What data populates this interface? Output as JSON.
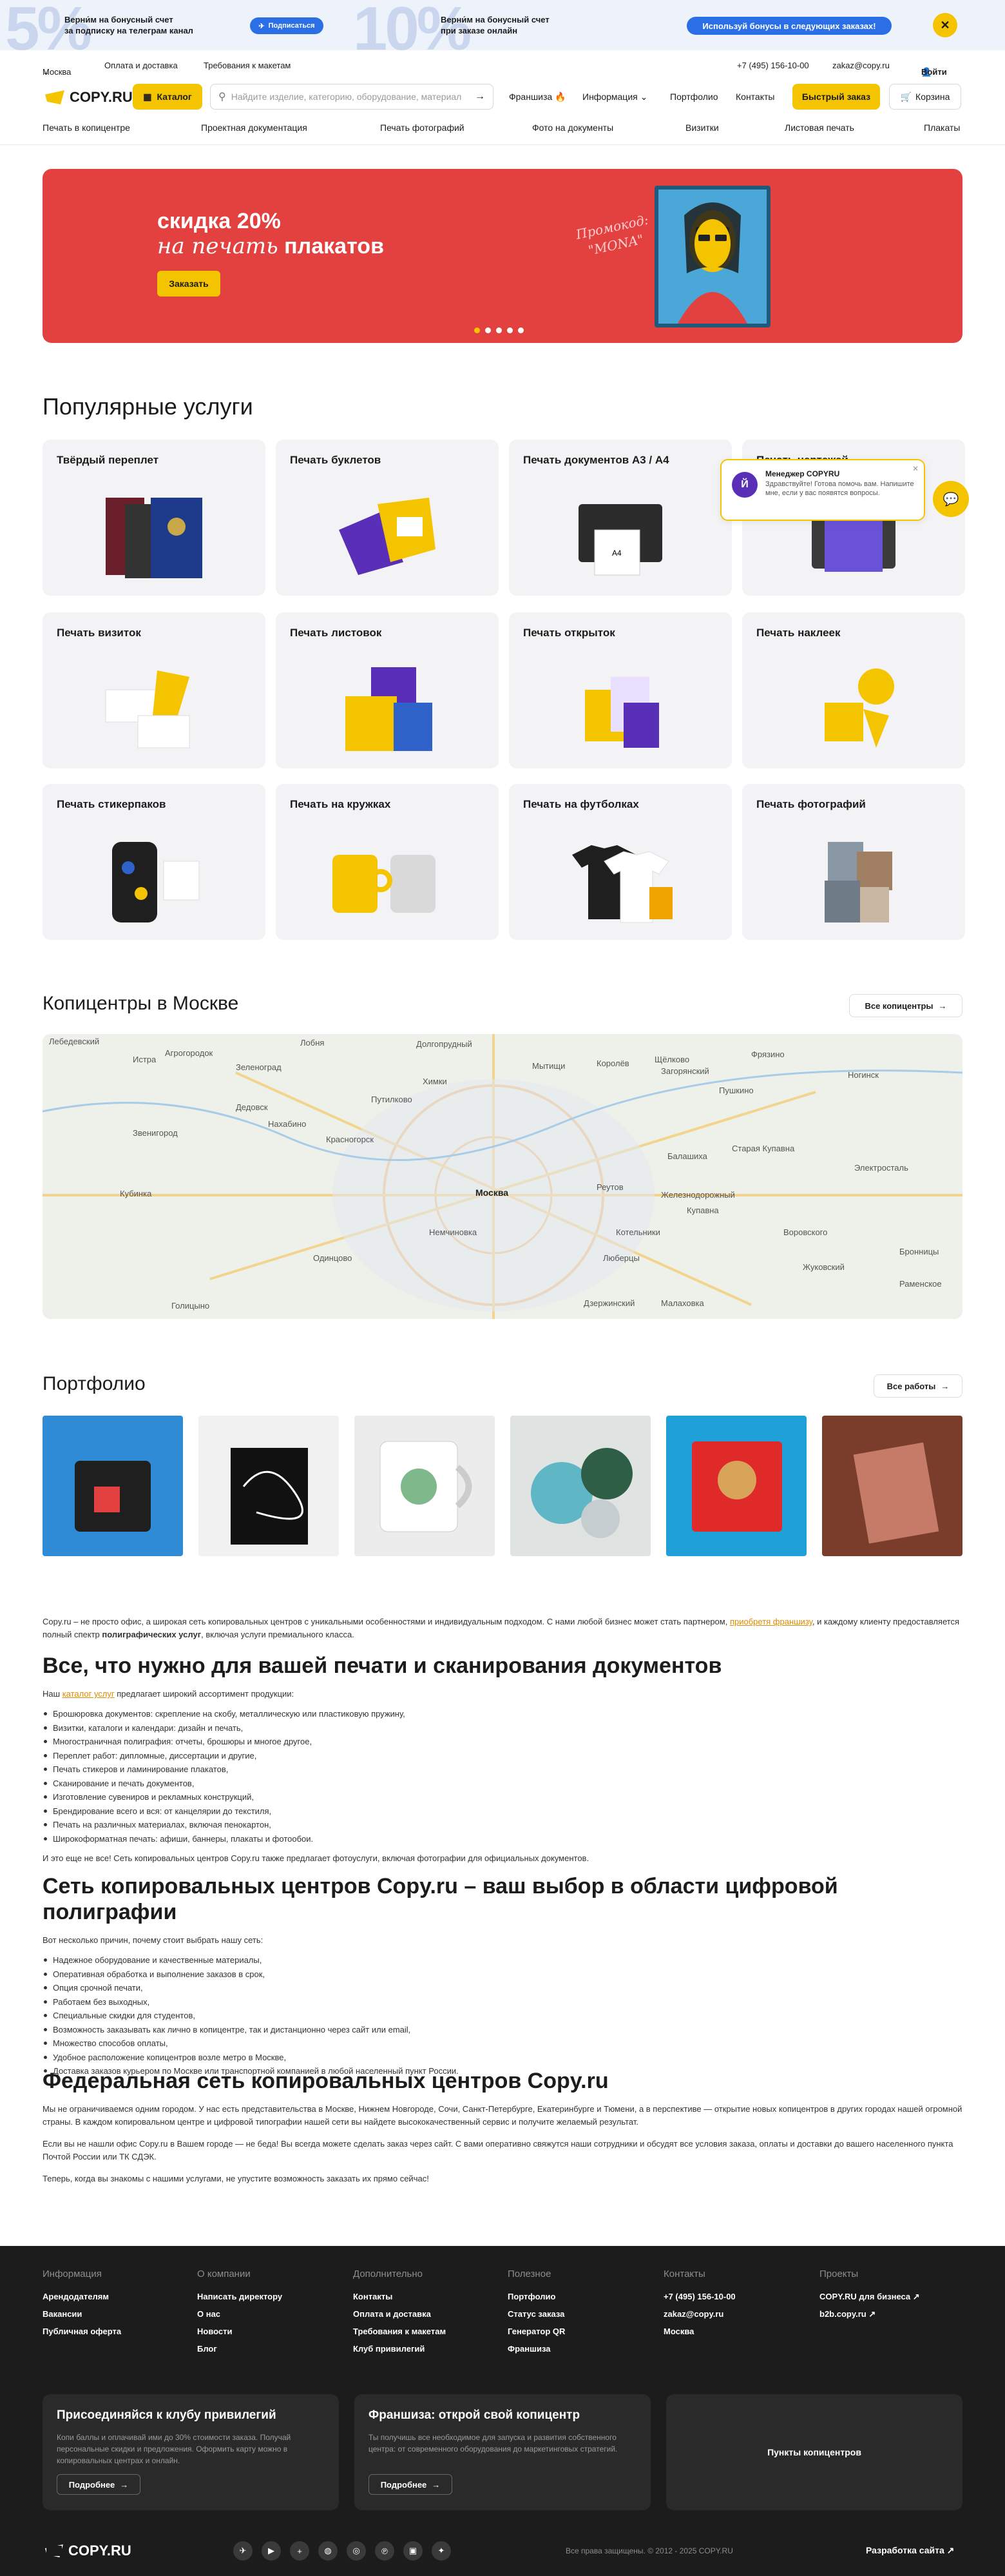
{
  "promo": {
    "big1": "5%",
    "text1a": "Верни́м на бонусный счет",
    "text1b": "за подписку на телеграм канал",
    "tg_btn": "Подписаться",
    "big2": "10%",
    "text2a": "Верни́м на бонусный счет",
    "text2b": "при заказе онлайн",
    "cta": "Используй бонусы в следующих заказах!"
  },
  "util": {
    "city": "Москва",
    "pay": "Оплата и доставка",
    "reqs": "Требования к макетам",
    "phone": "+7 (495) 156-10-00",
    "email": "zakaz@copy.ru",
    "login": "Войти"
  },
  "header": {
    "logo": "COPY.RU",
    "catalog": "Каталог",
    "search_placeholder": "Найдите изделие, категорию, оборудование, материал",
    "franchise": "Франшиза 🔥",
    "info": "Информация",
    "portfolio": "Портфолио",
    "contacts": "Контакты",
    "quick": "Быстрый заказ",
    "cart": "Корзина"
  },
  "catnav": [
    "Печать в копицентре",
    "Проектная документация",
    "Печать фотографий",
    "Фото на документы",
    "Визитки",
    "Листовая печать",
    "Плакаты"
  ],
  "banner": {
    "line1": "скидка 20%",
    "line2a": "на печать",
    "line2b": "плакатов",
    "button": "Заказать",
    "promo_a": "Промокод:",
    "promo_b": "\"MONA\""
  },
  "services": {
    "title": "Популярные услуги",
    "items": [
      "Твёрдый переплет",
      "Печать буклетов",
      "Печать документов А3 / А4",
      "Печать чертежей",
      "Печать визиток",
      "Печать листовок",
      "Печать открыток",
      "Печать наклеек",
      "Печать стикерпаков",
      "Печать на кружках",
      "Печать на футболках",
      "Печать фотографий"
    ]
  },
  "chat": {
    "name": "Менеджер COPYRU",
    "msg": "Здравствуйте! Готова помочь вам. Напишите мне, если у вас появятся вопросы."
  },
  "centers": {
    "title": "Копицентры в Москве",
    "all": "Все копицентры",
    "labels": [
      "Лебедевский",
      "Истра",
      "Агрогородок",
      "Зеленоград",
      "Долгопрудный",
      "Мытищи",
      "Королёв",
      "Щёлково",
      "Фрязино",
      "Загорянский",
      "Химки",
      "Лобня",
      "Пушкино",
      "Ногинск",
      "Звенигород",
      "Дедовск",
      "Нахабино",
      "Путилково",
      "Балашиха",
      "Электросталь",
      "Красногорск",
      "Москва",
      "Реутов",
      "Железнодорожный",
      "Старая Купавна",
      "Кубинка",
      "Одинцово",
      "Немчиновка",
      "Люберцы",
      "Котельники",
      "Жуковский",
      "Голицыно",
      "Раменское",
      "Дзержинский",
      "Малаховка",
      "Бронницы",
      "Купавна",
      "Воровского"
    ]
  },
  "portfolio": {
    "title": "Портфолио",
    "all": "Все работы"
  },
  "seo": {
    "intro_a": "Copy.ru – не просто офис, а широкая сеть копировальных центров с уникальными особенностями и индивидуальным подходом. С нами любой бизнес может стать партнером,",
    "intro_link": "приобретя франшизу",
    "intro_b": ", и каждому клиенту предоставляется полный спектр",
    "intro_bold": "полиграфических услуг",
    "intro_c": ", включая услуги премиального класса.",
    "h1": "Все, что нужно для вашей печати и сканирования документов",
    "p1a": "Наш",
    "p1link": "каталог услуг",
    "p1b": "предлагает широкий ассортимент продукции:",
    "list1": [
      "Брошюровка документов: скрепление на скобу, металлическую или пластиковую пружину,",
      "Визитки, каталоги и календари: дизайн и печать,",
      "Многостраничная полиграфия: отчеты, брошюры и многое другое,",
      "Переплет работ: дипломные, диссертации и другие,",
      "Печать стикеров и ламинирование плакатов,",
      "Сканирование и печать документов,",
      "Изготовление сувениров и рекламных конструкций,",
      "Брендирование всего и вся: от канцелярии до текстиля,",
      "Печать на различных материалах, включая пенокартон,",
      "Широкоформатная печать: афиши, баннеры, плакаты и фотообои."
    ],
    "p2": "И это еще не все! Сеть копировальных центров Copy.ru также предлагает фотоуслуги, включая фотографии для официальных документов.",
    "h2": "Сеть копировальных центров Copy.ru – ваш выбор в области цифровой полиграфии",
    "p3": "Вот несколько причин, почему стоит выбрать нашу сеть:",
    "list2": [
      "Надежное оборудование и качественные материалы,",
      "Оперативная обработка и выполнение заказов в срок,",
      "Опция срочной печати,",
      "Работаем без выходных,",
      "Специальные скидки для студентов,",
      "Возможность заказывать как лично в копицентре, так и дистанционно через сайт или email,",
      "Множество способов оплаты,",
      "Удобное расположение копицентров возле метро в Москве,",
      "Доставка заказов курьером по Москве или транспортной компанией в любой населенный пункт России."
    ],
    "h3": "Федеральная сеть копировальных центров Copy.ru",
    "p4": "Мы не ограничиваемся одним городом. У нас есть представительства в Москве, Нижнем Новгороде, Сочи, Санкт-Петербурге, Екатеринбурге и Тюмени, а в перспективе — открытие новых копицентров в других городах нашей огромной страны. В каждом копировальном центре и цифровой типографии нашей сети вы найдете высококачественный сервис и получите желаемый результат.",
    "p5": "Если вы не нашли офис Copy.ru в Вашем городе — не беда! Вы всегда можете сделать заказ через сайт. С вами оперативно свяжутся наши сотрудники и обсудят все условия заказа, оплаты и доставки до вашего населенного пункта Почтой России или ТК СДЭК.",
    "p6": "Теперь, когда вы знакомы с нашими услугами, не упустите возможность заказать их прямо сейчас!"
  },
  "footer": {
    "cols": [
      {
        "title": "Информация",
        "items": [
          "Арендодателям",
          "Вакансии",
          "Публичная оферта"
        ]
      },
      {
        "title": "О компании",
        "items": [
          "Написать директору",
          "О нас",
          "Новости",
          "Блог"
        ]
      },
      {
        "title": "Дополнительно",
        "items": [
          "Контакты",
          "Оплата и доставка",
          "Требования к макетам",
          "Клуб привилегий"
        ]
      },
      {
        "title": "Полезное",
        "items": [
          "Портфолио",
          "Статус заказа",
          "Генератор QR",
          "Франшиза"
        ]
      },
      {
        "title": "Контакты",
        "items": [
          "+7 (495) 156-10-00",
          "zakaz@copy.ru",
          "Москва"
        ]
      },
      {
        "title": "Проекты",
        "items": [
          "COPY.RU для бизнеса ↗",
          "b2b.copy.ru ↗"
        ]
      }
    ],
    "club_title": "Присоединяйся к клубу привилегий",
    "club_desc": "Копи баллы и оплачивай ими до 30% стоимости заказа. Получай персональные скидки и предложения. Оформить карту можно в копировальных центрах и онлайн.",
    "more": "Подробнее",
    "fr_title": "Франшиза: открой свой копицентр",
    "fr_desc": "Ты получишь все необходимое для запуска и развития собственного центра: от современного оборудования до маркетинговых стратегий.",
    "points": "Пункты копицентров",
    "logo": "COPY.RU",
    "copyright": "Все права защищены. © 2012 - 2025 COPY.RU",
    "dev": "Разработка сайта ↗"
  },
  "colors": {
    "accent": "#f5c400",
    "banner": "#e34040",
    "footer": "#1c1c1c",
    "link": "#e08a00"
  }
}
